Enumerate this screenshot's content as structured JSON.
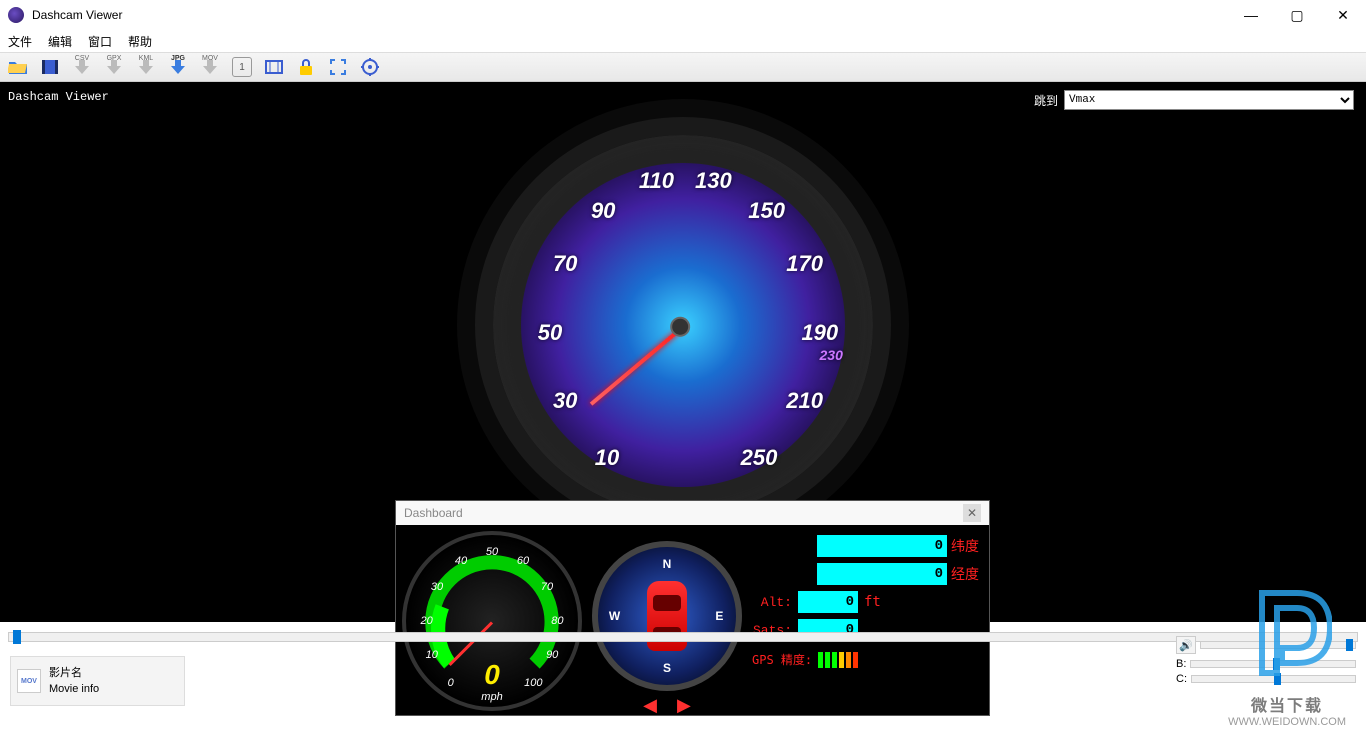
{
  "window": {
    "title": "Dashcam Viewer"
  },
  "menu": {
    "file": "文件",
    "edit": "编辑",
    "window": "窗口",
    "help": "帮助"
  },
  "toolbar": {
    "csv": "CSV",
    "gpx": "GPX",
    "kml": "KML",
    "jpg": "JPG",
    "mov": "MOV",
    "one": "1"
  },
  "viewport": {
    "title": "Dashcam Viewer",
    "jump_label": "跳到",
    "jump_value": "Vmax"
  },
  "big_gauge": {
    "ticks": [
      "10",
      "30",
      "50",
      "70",
      "90",
      "110",
      "130",
      "150",
      "170",
      "190",
      "210",
      "230",
      "250"
    ]
  },
  "dashboard": {
    "title": "Dashboard",
    "mini": {
      "ticks": [
        "0",
        "10",
        "20",
        "30",
        "40",
        "50",
        "60",
        "70",
        "80",
        "90",
        "100"
      ],
      "value": "0",
      "unit": "mph"
    },
    "compass": {
      "n": "N",
      "e": "E",
      "s": "S",
      "w": "W"
    },
    "data": {
      "lat_val": "0",
      "lat_lbl": "纬度",
      "lon_val": "0",
      "lon_lbl": "经度",
      "alt_lbl": "Alt:",
      "alt_val": "0",
      "alt_unit": "ft",
      "sats_lbl": "Sats:",
      "sats_val": "0",
      "gps_lbl": "GPS 精度:"
    }
  },
  "info": {
    "heading": "影片名",
    "sub": "Movie info"
  },
  "right": {
    "b": "B:",
    "c": "C:"
  },
  "watermark": {
    "t1": "微当下载",
    "t2": "WWW.WEIDOWN.COM"
  }
}
